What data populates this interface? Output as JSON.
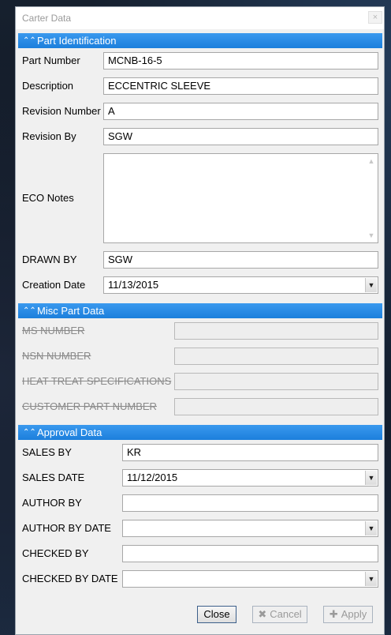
{
  "window": {
    "title": "Carter Data",
    "close_glyph": "×"
  },
  "sections": {
    "part_identification": "Part Identification",
    "misc_part_data": "Misc Part Data",
    "approval_data": "Approval Data"
  },
  "part": {
    "part_number_label": "Part Number",
    "part_number": "MCNB-16-5",
    "description_label": "Description",
    "description": "ECCENTRIC SLEEVE",
    "revision_number_label": "Revision Number",
    "revision_number": "A",
    "revision_by_label": "Revision By",
    "revision_by": "SGW",
    "eco_notes_label": "ECO Notes",
    "eco_notes": "",
    "drawn_by_label": "DRAWN BY",
    "drawn_by": "SGW",
    "creation_date_label": "Creation Date",
    "creation_date": "11/13/2015"
  },
  "misc": {
    "ms_number_label": "MS NUMBER",
    "ms_number": "",
    "nsn_number_label": "NSN NUMBER",
    "nsn_number": "",
    "heat_treat_label": "HEAT TREAT SPECIFICATIONS",
    "heat_treat": "",
    "customer_part_label": "CUSTOMER PART NUMBER",
    "customer_part": ""
  },
  "approval": {
    "sales_by_label": "SALES BY",
    "sales_by": "KR",
    "sales_date_label": "SALES DATE",
    "sales_date": "11/12/2015",
    "author_by_label": "AUTHOR BY",
    "author_by": "",
    "author_by_date_label": "AUTHOR BY DATE",
    "author_by_date": "",
    "checked_by_label": "CHECKED BY",
    "checked_by": "",
    "checked_by_date_label": "CHECKED BY DATE",
    "checked_by_date": ""
  },
  "buttons": {
    "close": "Close",
    "cancel": "Cancel",
    "apply": "Apply"
  },
  "icons": {
    "collapse": "chevron-double-up-icon",
    "cancel": "x-icon",
    "apply": "plus-icon",
    "dropdown": "caret-down-icon"
  },
  "colors": {
    "section_header": "#1c7fdc",
    "dialog_bg": "#f0f0f0"
  }
}
